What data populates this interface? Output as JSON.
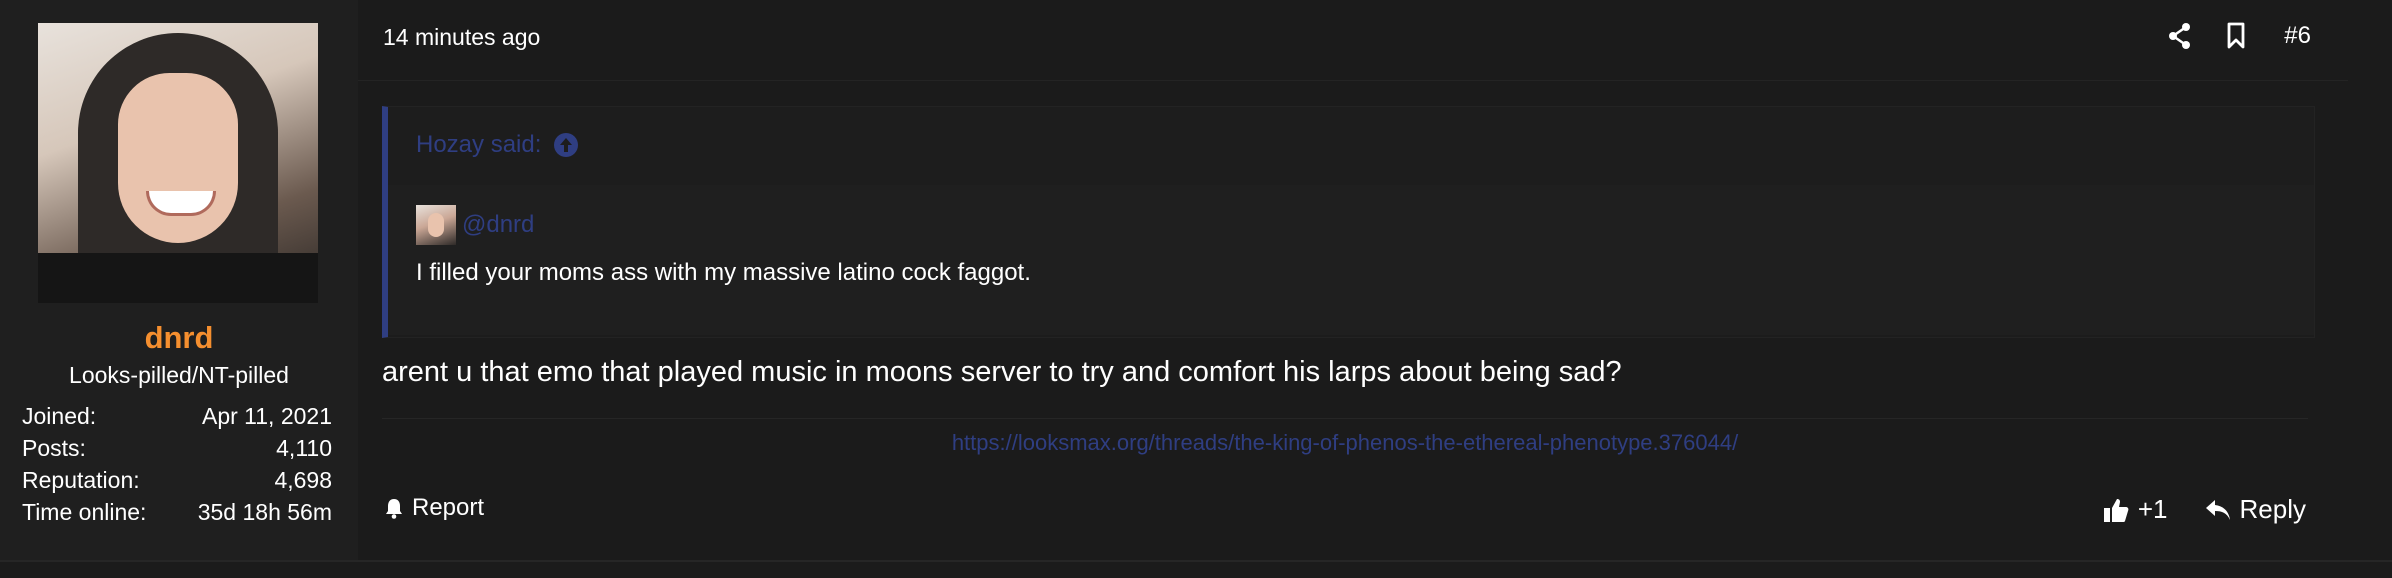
{
  "user": {
    "name": "dnrd",
    "title": "Looks-pilled/NT-pilled",
    "stats": [
      {
        "label": "Joined:",
        "value": "Apr 11, 2021"
      },
      {
        "label": "Posts:",
        "value": "4,110"
      },
      {
        "label": "Reputation:",
        "value": "4,698"
      },
      {
        "label": "Time online:",
        "value": "35d 18h 56m"
      }
    ]
  },
  "post": {
    "date": "14 minutes ago",
    "number": "#6",
    "quote": {
      "author_label": "Hozay said:",
      "mention": "@dnrd",
      "text": "I filled your moms ass with my massive latino cock faggot."
    },
    "body": "arent u that emo that played music in moons server to try and comfort his larps about being sad?",
    "link": "https://looksmax.org/threads/the-king-of-phenos-the-ethereal-phenotype.376044/",
    "actions": {
      "report": "Report",
      "like": "+1",
      "reply": "Reply"
    }
  },
  "icons": {
    "share": "share-icon",
    "bookmark": "bookmark-icon",
    "arrow_up": "arrow-up-circle-icon",
    "bell": "bell-icon",
    "thumbs_up": "thumbs-up-icon",
    "reply": "reply-arrow-icon"
  },
  "colors": {
    "username": "#f58f2f",
    "link": "#2f3e82",
    "quote_border": "#2f3e82",
    "background": "#1b1b1b"
  }
}
